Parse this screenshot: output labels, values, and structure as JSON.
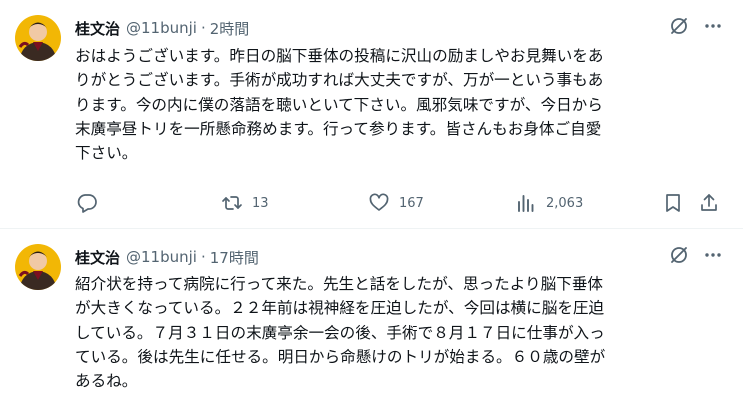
{
  "tweets": [
    {
      "author": {
        "display_name": "桂文治",
        "handle": "@11bunji"
      },
      "separator": "·",
      "time": "2時間",
      "text": "おはようございます。昨日の脳下垂体の投稿に沢山の励ましやお見舞いをあ\nりがとうございます。手術が成功すれば大丈夫ですが、万が一という事もあ\nります。今の内に僕の落語を聴いといて下さい。風邪気味ですが、今日から\n末廣亭昼トリを一所懸命務めます。行って参ります。皆さんもお身体ご自愛\n下さい。",
      "metrics": {
        "replies": "",
        "retweets": "13",
        "likes": "167",
        "views": "2,063"
      }
    },
    {
      "author": {
        "display_name": "桂文治",
        "handle": "@11bunji"
      },
      "separator": "·",
      "time": "17時間",
      "text": "紹介状を持って病院に行って来た。先生と話をしたが、思ったより脳下垂体\nが大きくなっている。２２年前は視神経を圧迫したが、今回は横に脳を圧迫\nしている。７月３１日の末廣亭余一会の後、手術で８月１７日に仕事が入っ\nている。後は先生に任せる。明日から命懸けのトリが始まる。６０歳の壁が\nあるね。"
    }
  ],
  "icons": {
    "grok": "grok-icon",
    "more": "more-icon",
    "reply": "reply-icon",
    "retweet": "retweet-icon",
    "like": "heart-icon",
    "views": "views-icon",
    "bookmark": "bookmark-icon",
    "share": "share-icon"
  },
  "colors": {
    "text_primary": "#0f1419",
    "text_secondary": "#536471",
    "divider": "#eff3f4",
    "background": "#ffffff"
  }
}
